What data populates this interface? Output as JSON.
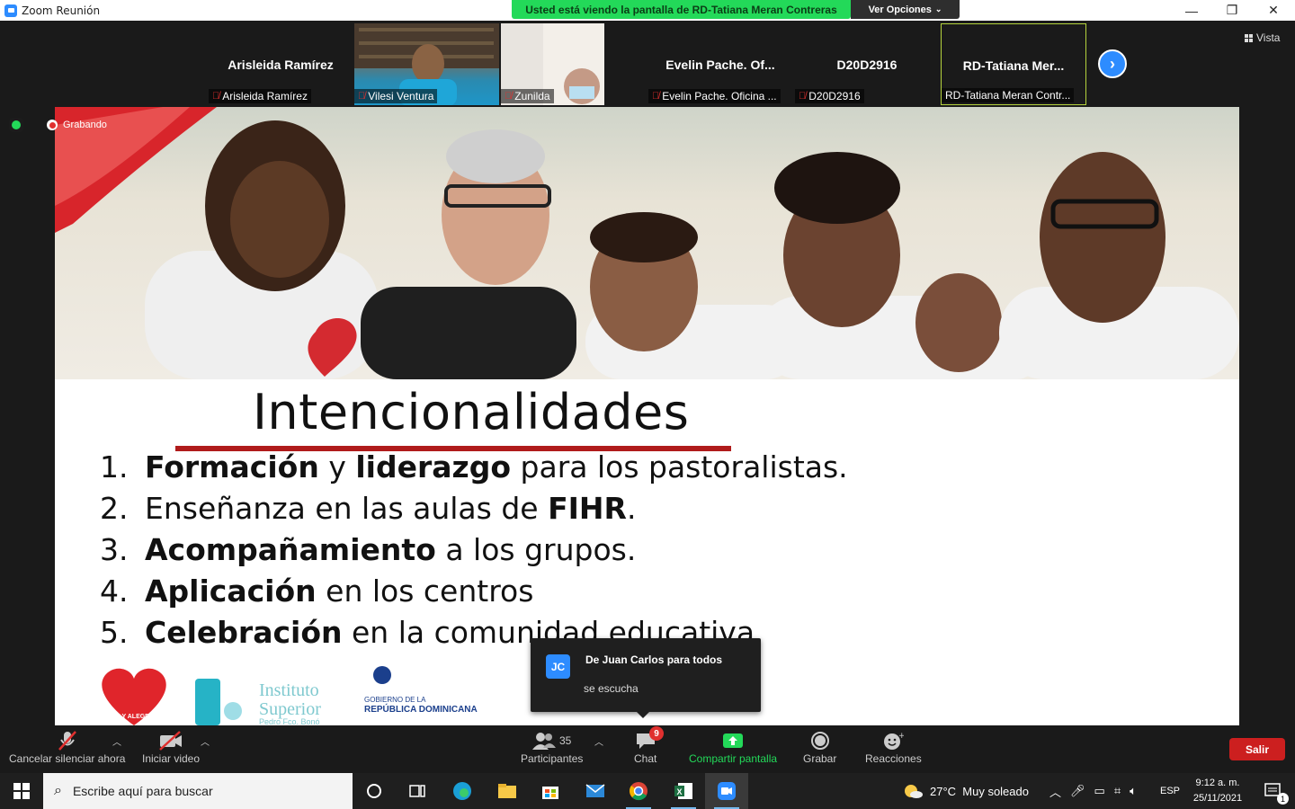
{
  "window": {
    "title": "Zoom Reunión",
    "share_banner": "Usted está viendo la pantalla de RD-Tatiana Meran Contreras",
    "view_options": "Ver Opciones",
    "minimize": "—",
    "maximize": "❐",
    "close": "✕"
  },
  "participants_strip": [
    {
      "display": "Arisleida Ramírez",
      "label": "Arisleida Ramírez",
      "video": false
    },
    {
      "display": "",
      "label": "Vilesi Ventura",
      "video": true
    },
    {
      "display": "",
      "label": "Zunilda",
      "video": true
    },
    {
      "display": "Evelin  Pache.  Of...",
      "label": "Evelin Pache. Oficina ...",
      "video": false
    },
    {
      "display": "D20D2916",
      "label": "D20D2916",
      "video": false
    },
    {
      "display": "RD-Tatiana  Mer...",
      "label": "RD-Tatiana Meran Contr...",
      "video": false
    }
  ],
  "view_button": "Vista",
  "recording": "Grabando",
  "slide": {
    "title": "Intencionalidades",
    "items": [
      {
        "num": "1.",
        "parts": [
          {
            "t": "Formación",
            "b": true
          },
          {
            "t": " y ",
            "b": false
          },
          {
            "t": "liderazgo",
            "b": true
          },
          {
            "t": " para los pastoralistas.",
            "b": false
          }
        ]
      },
      {
        "num": "2.",
        "parts": [
          {
            "t": "Enseñanza en las aulas de ",
            "b": false
          },
          {
            "t": "FIHR",
            "b": true
          },
          {
            "t": ".",
            "b": false
          }
        ]
      },
      {
        "num": "3.",
        "parts": [
          {
            "t": "Acompañamiento",
            "b": true
          },
          {
            "t": " a los grupos.",
            "b": false
          }
        ]
      },
      {
        "num": "4.",
        "parts": [
          {
            "t": "Aplicación",
            "b": true
          },
          {
            "t": " en los centros",
            "b": false
          }
        ]
      },
      {
        "num": "5.",
        "parts": [
          {
            "t": "Celebración",
            "b": true
          },
          {
            "t": " en la comunidad educativa",
            "b": false
          }
        ]
      }
    ],
    "logos": {
      "fya": "FE Y ALEGRIA",
      "instituto_1": "Instituto",
      "instituto_2": "Superior",
      "instituto_3": "Pedro Fco. Bonó",
      "gov_1": "GOBIERNO DE LA",
      "gov_2": "REPÚBLICA DOMINICANA"
    }
  },
  "chat_toast": {
    "avatar": "JC",
    "from": "De Juan Carlos para todos",
    "message": "se escucha"
  },
  "toolbar": {
    "unmute": "Cancelar silenciar ahora",
    "start_video": "Iniciar video",
    "participants": "Participantes",
    "participants_count": "35",
    "chat": "Chat",
    "chat_badge": "9",
    "share": "Compartir pantalla",
    "record": "Grabar",
    "reactions": "Reacciones",
    "exit": "Salir"
  },
  "taskbar": {
    "search_placeholder": "Escribe aquí para buscar",
    "weather": "27°C  Muy soleado",
    "lang": "ESP",
    "time": "9:12 a. m.",
    "date": "25/11/2021",
    "notif_count": "1"
  },
  "colors": {
    "zoom_blue": "#2D8CFF",
    "share_green": "#23D959",
    "exit_red": "#cc1f1f",
    "title_underline": "#b01b1b"
  }
}
